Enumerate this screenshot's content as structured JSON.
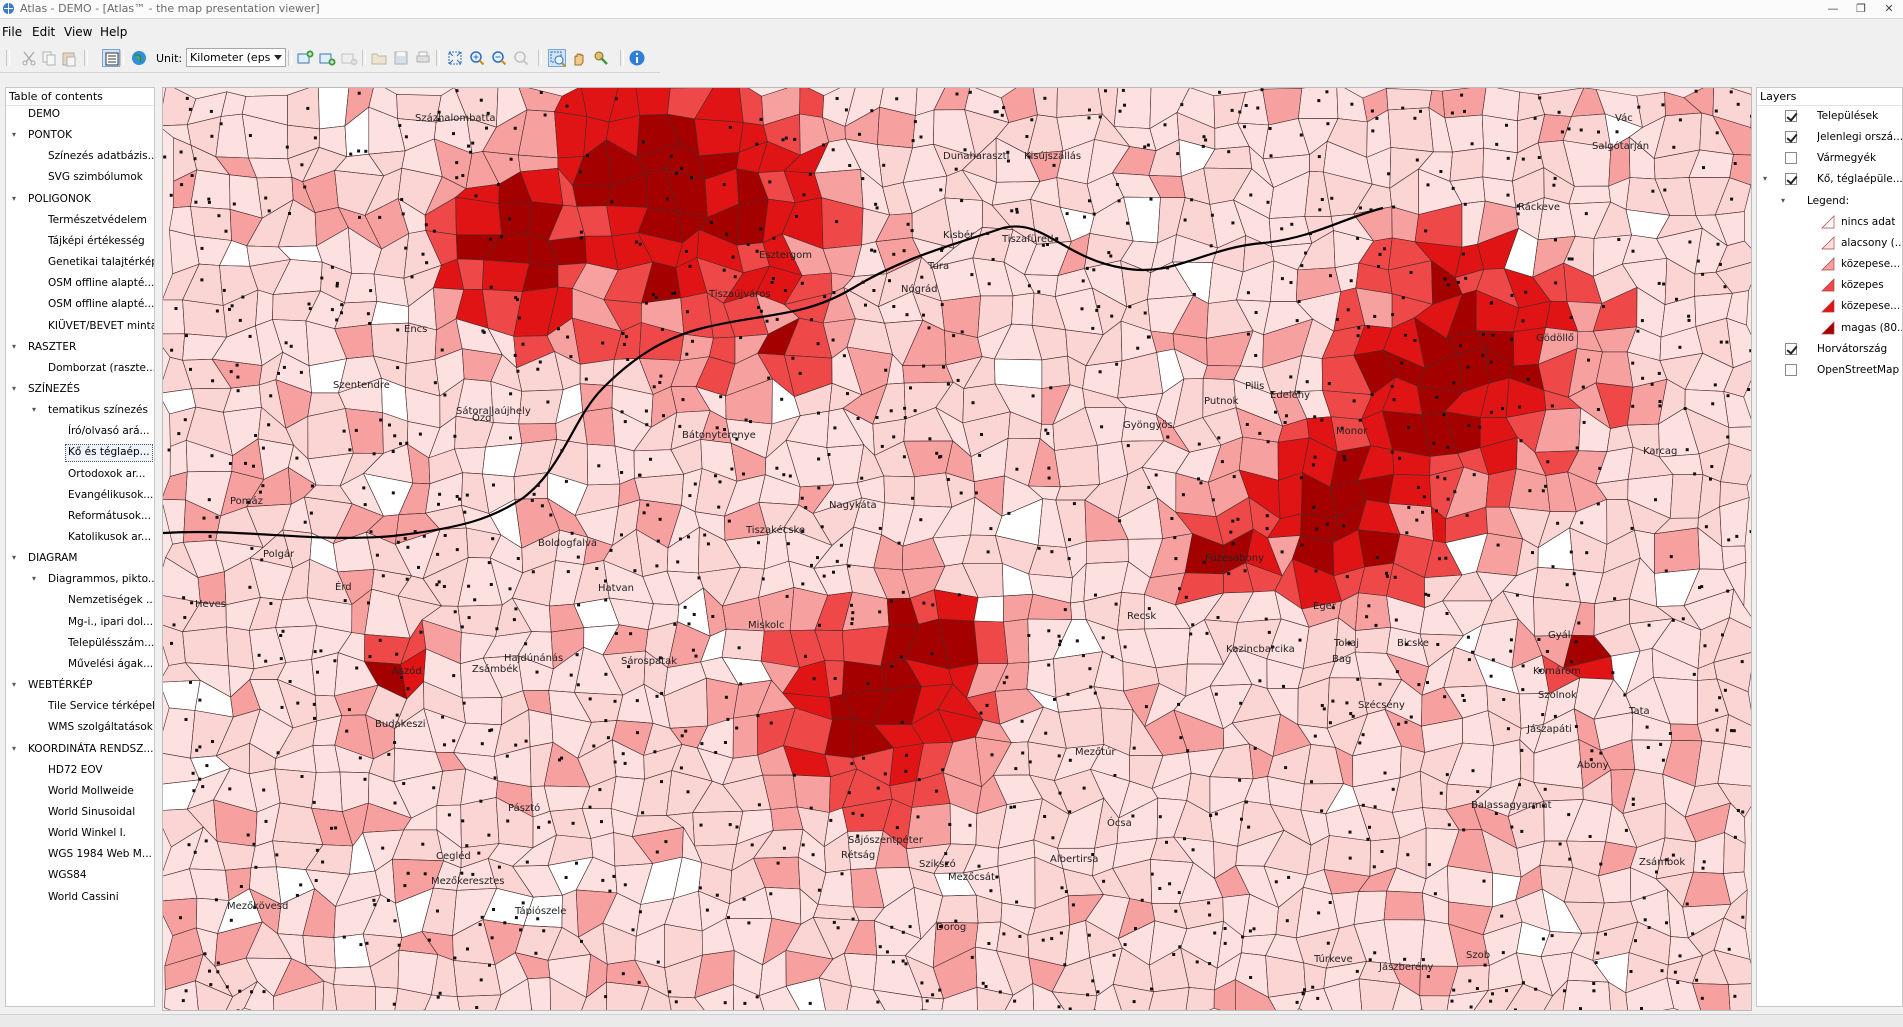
{
  "window": {
    "title": "Atlas - DEMO - [Atlas™ - the map presentation viewer]",
    "minimize": "—",
    "restore": "❐",
    "close": "✕"
  },
  "menu": [
    "File",
    "Edit",
    "View",
    "Help"
  ],
  "toolbar": {
    "unit_label": "Unit:",
    "unit_value": "Kilometer (eps",
    "buttons": [
      {
        "icon": "cut-icon",
        "enabled": false
      },
      {
        "icon": "copy-icon",
        "enabled": false
      },
      {
        "icon": "paste-icon",
        "enabled": false
      },
      {
        "icon": "layout-icon",
        "enabled": true,
        "checked": true
      },
      {
        "icon": "globe-icon",
        "enabled": true
      },
      {
        "icon": "add-layer-icon",
        "enabled": true
      },
      {
        "icon": "add-group-icon",
        "enabled": true
      },
      {
        "icon": "remove-layer-icon",
        "enabled": false
      },
      {
        "icon": "open-icon",
        "enabled": false
      },
      {
        "icon": "save-icon",
        "enabled": false
      },
      {
        "icon": "print-icon",
        "enabled": false
      },
      {
        "icon": "zoom-extent-icon",
        "enabled": true
      },
      {
        "icon": "zoom-in-icon",
        "enabled": true
      },
      {
        "icon": "zoom-out-icon",
        "enabled": true
      },
      {
        "icon": "zoom-previous-icon",
        "enabled": false
      },
      {
        "icon": "zoom-window-icon",
        "enabled": true,
        "checked": true
      },
      {
        "icon": "pan-hand-icon",
        "enabled": true
      },
      {
        "icon": "identify-icon",
        "enabled": true
      },
      {
        "icon": "info-icon",
        "enabled": true
      }
    ]
  },
  "toc": {
    "header": "Table of contents",
    "items": [
      {
        "label": "DEMO",
        "level": 1,
        "expander": ""
      },
      {
        "label": "PONTOK",
        "level": 1,
        "expander": "▾"
      },
      {
        "label": "Színezés adatbázis...",
        "level": 2,
        "expander": ""
      },
      {
        "label": "SVG szimbólumok",
        "level": 2,
        "expander": ""
      },
      {
        "label": "POLIGONOK",
        "level": 1,
        "expander": "▾"
      },
      {
        "label": "Természetvédelem",
        "level": 2,
        "expander": ""
      },
      {
        "label": "Tájképi értékesség",
        "level": 2,
        "expander": ""
      },
      {
        "label": "Genetikai talajtérkép",
        "level": 2,
        "expander": ""
      },
      {
        "label": "OSM offline alapté...",
        "level": 2,
        "expander": ""
      },
      {
        "label": "OSM offline alapté...",
        "level": 2,
        "expander": ""
      },
      {
        "label": "KIÜVET/BEVET minta",
        "level": 2,
        "expander": ""
      },
      {
        "label": "RASZTER",
        "level": 1,
        "expander": "▾"
      },
      {
        "label": "Domborzat (raszte...",
        "level": 2,
        "expander": ""
      },
      {
        "label": "SZÍNEZÉS",
        "level": 1,
        "expander": "▾"
      },
      {
        "label": "tematikus színezés",
        "level": 2,
        "expander": "▾"
      },
      {
        "label": "Író/olvasó ará...",
        "level": 3,
        "expander": ""
      },
      {
        "label": "Kő és téglaép...",
        "level": 3,
        "expander": "",
        "selected": true
      },
      {
        "label": "Ortodoxok ar...",
        "level": 3,
        "expander": ""
      },
      {
        "label": "Evangélikusok...",
        "level": 3,
        "expander": ""
      },
      {
        "label": "Reformátusok...",
        "level": 3,
        "expander": ""
      },
      {
        "label": "Katolikusok ar...",
        "level": 3,
        "expander": ""
      },
      {
        "label": "DIAGRAM",
        "level": 1,
        "expander": "▾"
      },
      {
        "label": "Diagrammos, pikto...",
        "level": 2,
        "expander": "▾"
      },
      {
        "label": "Nemzetiségek ...",
        "level": 3,
        "expander": ""
      },
      {
        "label": "Mg-i., ipari dol...",
        "level": 3,
        "expander": ""
      },
      {
        "label": "Településszám...",
        "level": 3,
        "expander": ""
      },
      {
        "label": "Művelési ágak...",
        "level": 3,
        "expander": ""
      },
      {
        "label": "WEBTÉRKÉP",
        "level": 1,
        "expander": "▾"
      },
      {
        "label": "Tile Service térképek",
        "level": 2,
        "expander": ""
      },
      {
        "label": "WMS szolgáltatások",
        "level": 2,
        "expander": ""
      },
      {
        "label": "KOORDINÁTA RENDSZ...",
        "level": 1,
        "expander": "▾"
      },
      {
        "label": "HD72 EOV",
        "level": 2,
        "expander": ""
      },
      {
        "label": "World Mollweide",
        "level": 2,
        "expander": ""
      },
      {
        "label": "World Sinusoidal",
        "level": 2,
        "expander": ""
      },
      {
        "label": "World Winkel I.",
        "level": 2,
        "expander": ""
      },
      {
        "label": "WGS 1984 Web M...",
        "level": 2,
        "expander": ""
      },
      {
        "label": "WGS84",
        "level": 2,
        "expander": ""
      },
      {
        "label": "World Cassini",
        "level": 2,
        "expander": ""
      }
    ]
  },
  "map": {
    "region_labels": [
      "Mezőkeresztes",
      "Ózd",
      "Heves",
      "Boldogfalva",
      "Szentendre",
      "Pomáz",
      "Zsámbok",
      "Tura",
      "Jászberény",
      "Gyöngyös",
      "Hatvan",
      "Vác",
      "Szob",
      "Nógrád",
      "Balassagyarmat",
      "Salgótarján",
      "Pásztó",
      "Füzesabony",
      "Mezőkövesd",
      "Tiszafüred",
      "Abony",
      "Cegléd",
      "Monor",
      "Gödöllő",
      "Aszód",
      "Bag",
      "Recsk",
      "Eger",
      "Sajószentpéter",
      "Kazincbarcika",
      "Encs",
      "Szikszó",
      "Tokaj",
      "Sárospatak",
      "Sátoraljaújhely",
      "Rétság",
      "Szécsény",
      "Nagykáta",
      "Tápiószele",
      "Jászapáti",
      "Kisújszállás",
      "Karcag",
      "Tiszaújváros",
      "Mezőcsát",
      "Hajdúnánás",
      "Polgár",
      "Miskolc",
      "Edelény",
      "Putnok",
      "Bátonyterenye",
      "Esztergom",
      "Dorog",
      "Budakeszi",
      "Zsámbék",
      "Tata",
      "Komárom",
      "Kisbér",
      "Bicske",
      "Érd",
      "Százhalombatta",
      "Ráckeve",
      "Dunaharaszti",
      "Gyál",
      "Ócsa",
      "Pilis",
      "Albertirsa",
      "Tiszakécske",
      "Szolnok",
      "Túrkeve",
      "Mezőtúr"
    ]
  },
  "layers": {
    "header": "Layers",
    "items": [
      {
        "label": "Települések",
        "checkbox": true,
        "checked": true,
        "indent": 0,
        "expander": ""
      },
      {
        "label": "Jelenlegi orszá...",
        "checkbox": true,
        "checked": true,
        "indent": 0,
        "expander": ""
      },
      {
        "label": "Vármegyék",
        "checkbox": true,
        "checked": false,
        "indent": 0,
        "expander": ""
      },
      {
        "label": "Kő, téglaépüle...",
        "checkbox": true,
        "checked": true,
        "indent": 0,
        "expander": "▾"
      },
      {
        "label": "Legend:",
        "checkbox": false,
        "indent": 1,
        "expander": "▾"
      },
      {
        "label": "nincs adat",
        "checkbox": false,
        "indent": 2,
        "swatch": "#ffffff"
      },
      {
        "label": "alacsony (...",
        "checkbox": false,
        "indent": 2,
        "swatch": "#fde0e0"
      },
      {
        "label": "közepese...",
        "checkbox": false,
        "indent": 2,
        "swatch": "#f7a0a0"
      },
      {
        "label": "közepes",
        "checkbox": false,
        "indent": 2,
        "swatch": "#ee4848"
      },
      {
        "label": "közepese...",
        "checkbox": false,
        "indent": 2,
        "swatch": "#e01414"
      },
      {
        "label": "magas (80...",
        "checkbox": false,
        "indent": 2,
        "swatch": "#a40000"
      },
      {
        "label": "Horvátország",
        "checkbox": true,
        "checked": true,
        "indent": 0,
        "expander": ""
      },
      {
        "label": "OpenStreetMap",
        "checkbox": true,
        "checked": false,
        "indent": 0,
        "expander": ""
      }
    ]
  },
  "colors": {
    "nincs_adat": "#ffffff",
    "alacsony": "#fde0e0",
    "kozepes_alacsony": "#f7a0a0",
    "kozepes": "#ee4848",
    "kozepes_magas": "#e01414",
    "magas": "#a40000",
    "accent": "#cfe4f7"
  }
}
